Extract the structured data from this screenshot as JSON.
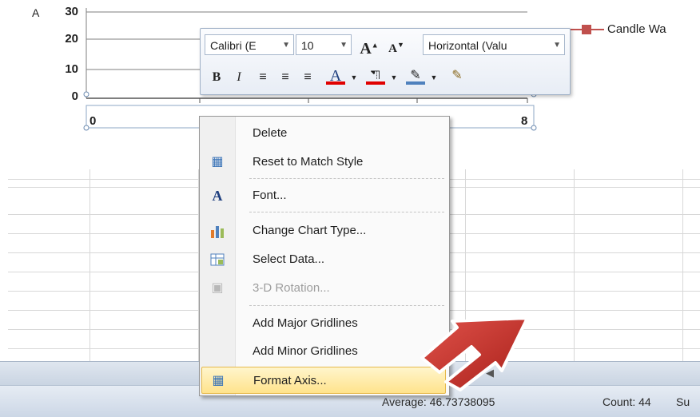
{
  "chart": {
    "axis_title": "A",
    "y_ticks": [
      "30",
      "20",
      "10",
      "0"
    ],
    "x_ticks": [
      "0",
      "8"
    ],
    "legend": "Candle Wa"
  },
  "mini_toolbar": {
    "font_name": "Calibri (E",
    "font_size": "10",
    "axis_select": "Horizontal (Valu",
    "bold": "B",
    "italic": "I",
    "font_color": "#e00000",
    "fill_color": "#e00000",
    "line_color": "#4f81bd"
  },
  "context_menu": {
    "items": [
      {
        "label": "Delete",
        "icon": "none",
        "disabled": false
      },
      {
        "label": "Reset to Match Style",
        "icon": "reset-style-icon",
        "disabled": false
      },
      {
        "label": "Font...",
        "icon": "font-icon",
        "disabled": false
      },
      {
        "label": "Change Chart Type...",
        "icon": "chart-type-icon",
        "disabled": false
      },
      {
        "label": "Select Data...",
        "icon": "select-data-icon",
        "disabled": false
      },
      {
        "label": "3-D Rotation...",
        "icon": "rotation-3d-icon",
        "disabled": true
      },
      {
        "label": "Add Major Gridlines",
        "icon": "none",
        "disabled": false
      },
      {
        "label": "Add Minor Gridlines",
        "icon": "none",
        "disabled": false
      },
      {
        "label": "Format Axis...",
        "icon": "format-axis-icon",
        "disabled": false,
        "highlighted": true
      }
    ]
  },
  "status_bar": {
    "average": "Average: 46.73738095",
    "count": "Count: 44",
    "sum": "Su"
  }
}
